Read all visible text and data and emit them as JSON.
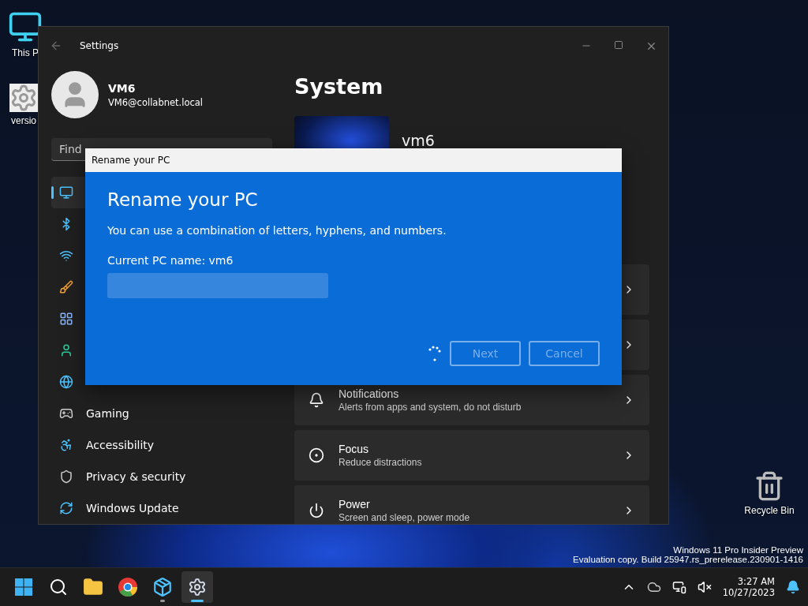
{
  "desktop": {
    "icons": [
      {
        "kind": "monitor",
        "label": "This P"
      },
      {
        "kind": "settings-file",
        "label": "versio"
      },
      {
        "kind": "recycle-bin",
        "label": "Recycle Bin"
      }
    ],
    "watermark": [
      "Windows 11 Pro Insider Preview",
      "Evaluation copy. Build 25947.rs_prerelease.230901-1416"
    ]
  },
  "settings_window": {
    "title": "Settings",
    "user": {
      "name": "VM6",
      "email": "VM6@collabnet.local"
    },
    "search": {
      "placeholder": "Find"
    },
    "nav": [
      {
        "kind": "display",
        "selected": true
      },
      {
        "kind": "bluetooth",
        "selected": false
      },
      {
        "kind": "wifi",
        "selected": false
      },
      {
        "kind": "brush",
        "selected": false
      },
      {
        "kind": "apps",
        "selected": false
      },
      {
        "kind": "account",
        "selected": false
      },
      {
        "kind": "globe",
        "selected": false
      },
      {
        "kind": "gamepad",
        "label": "Gaming",
        "selected": false
      },
      {
        "kind": "accessibility",
        "label": "Accessibility",
        "selected": false
      },
      {
        "kind": "shield",
        "label": "Privacy & security",
        "selected": false
      },
      {
        "kind": "update",
        "label": "Windows Update",
        "selected": false
      }
    ],
    "page_title": "System",
    "device": {
      "name": "vm6"
    },
    "cards": [
      {
        "kind": "plain"
      },
      {
        "kind": "plain"
      },
      {
        "kind": "bell",
        "title": "Notifications",
        "subtitle": "Alerts from apps and system, do not disturb"
      },
      {
        "kind": "focus",
        "title": "Focus",
        "subtitle": "Reduce distractions"
      },
      {
        "kind": "power",
        "title": "Power",
        "subtitle": "Screen and sleep, power mode"
      }
    ]
  },
  "dialog": {
    "title": "Rename your PC",
    "heading": "Rename your PC",
    "description": "You can use a combination of letters, hyphens, and numbers.",
    "current_name": "Current PC name: vm6",
    "busy": true,
    "buttons": [
      {
        "label": "Next",
        "disabled": true
      },
      {
        "label": "Cancel",
        "disabled": true
      }
    ]
  },
  "taskbar": {
    "apps": [
      {
        "kind": "start",
        "active": false,
        "running": false
      },
      {
        "kind": "search",
        "active": false,
        "running": false
      },
      {
        "kind": "folder",
        "active": false,
        "running": false
      },
      {
        "kind": "browser",
        "active": false,
        "running": false
      },
      {
        "kind": "installer",
        "active": false,
        "running": true
      },
      {
        "kind": "settings",
        "active": true,
        "running": true
      }
    ],
    "tray": [
      {
        "kind": "chevron-up"
      },
      {
        "kind": "cloud"
      },
      {
        "kind": "network"
      },
      {
        "kind": "volume-muted"
      }
    ],
    "time": "3:27 AM",
    "date": "10/27/2023"
  }
}
